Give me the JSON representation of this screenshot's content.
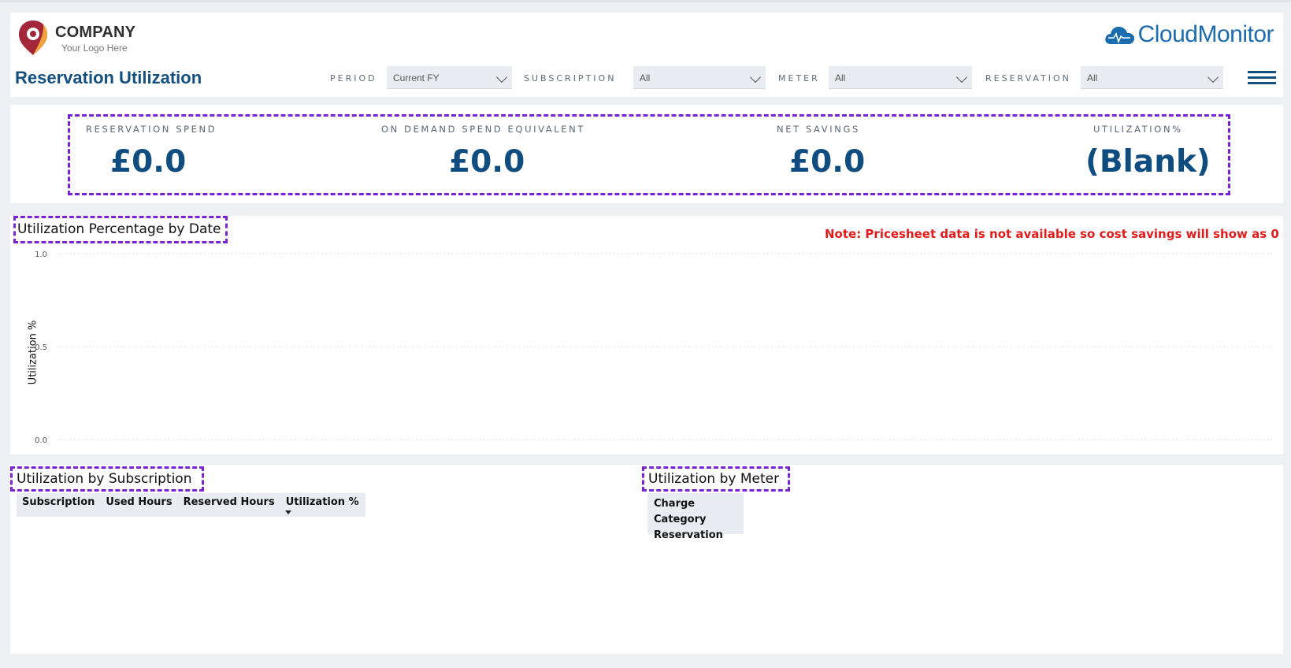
{
  "logo": {
    "name": "COMPANY",
    "tagline": "Your Logo Here",
    "accent_color": "#a4263a"
  },
  "brand": {
    "name": "CloudMonitor",
    "color": "#1c6cb0",
    "icon": "cloud-pulse-icon"
  },
  "page": {
    "title": "Reservation Utilization",
    "menu_icon": "hamburger-menu-icon"
  },
  "filters": {
    "period": {
      "label": "PERIOD",
      "value": "Current FY"
    },
    "subscription": {
      "label": "SUBSCRIPTION",
      "value": "All"
    },
    "meter": {
      "label": "METER",
      "value": "All"
    },
    "reservation": {
      "label": "RESERVATION",
      "value": "All"
    }
  },
  "kpis": {
    "reservation_spend": {
      "label": "RESERVATION SPEND",
      "value": "£0.0"
    },
    "on_demand_equivalent": {
      "label": "ON DEMAND SPEND EQUIVALENT",
      "value": "£0.0"
    },
    "net_savings": {
      "label": "NET SAVINGS",
      "value": "£0.0"
    },
    "utilization": {
      "label": "UTILIZATION%",
      "value": "(Blank)"
    }
  },
  "chart_section": {
    "title": "Utilization Percentage by Date",
    "note": "Note: Pricesheet data is not available so cost savings will show as 0"
  },
  "chart_data": {
    "type": "line",
    "title": "Utilization Percentage by Date",
    "xlabel": "",
    "ylabel": "Utilization %",
    "ylim": [
      0.0,
      1.0
    ],
    "y_ticks": [
      "1.0",
      "0.5",
      "0.0"
    ],
    "grid": true,
    "series": []
  },
  "subscription_table": {
    "title": "Utilization by Subscription",
    "columns": [
      "Subscription",
      "Used Hours",
      "Reserved Hours",
      "Utilization %"
    ],
    "sorted_column": "Utilization %",
    "rows": []
  },
  "meter_table": {
    "title": "Utilization by Meter",
    "columns": [
      "Charge Category",
      "Reservation"
    ],
    "rows": []
  },
  "colors": {
    "title_blue": "#14507f",
    "kpi_blue": "#0f4d80",
    "highlight_purple": "#7a23d6",
    "note_red": "#e21b1b"
  }
}
